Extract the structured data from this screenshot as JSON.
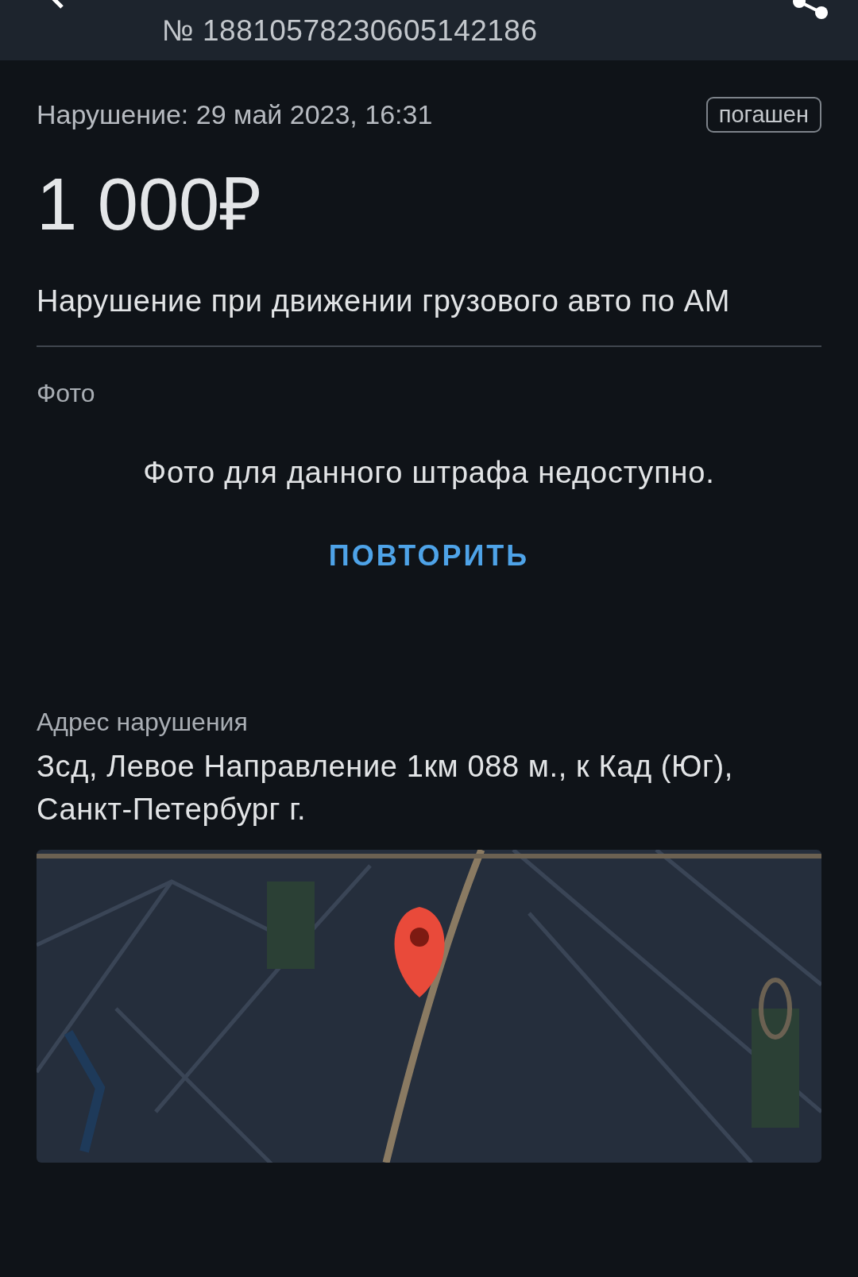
{
  "header": {
    "number": "№ 18810578230605142186"
  },
  "violation": {
    "datetime": "Нарушение: 29 май 2023, 16:31",
    "status": "погашен",
    "amount": "1 000₽",
    "description": "Нарушение при движении грузового авто по АМ"
  },
  "photo": {
    "label": "Фото",
    "message": "Фото для данного штрафа недоступно.",
    "retry": "ПОВТОРИТЬ"
  },
  "address": {
    "label": "Адрес нарушения",
    "value": "Зсд, Левое Направление 1км 088 м., к Кад (Юг), Санкт-Петербург г."
  }
}
